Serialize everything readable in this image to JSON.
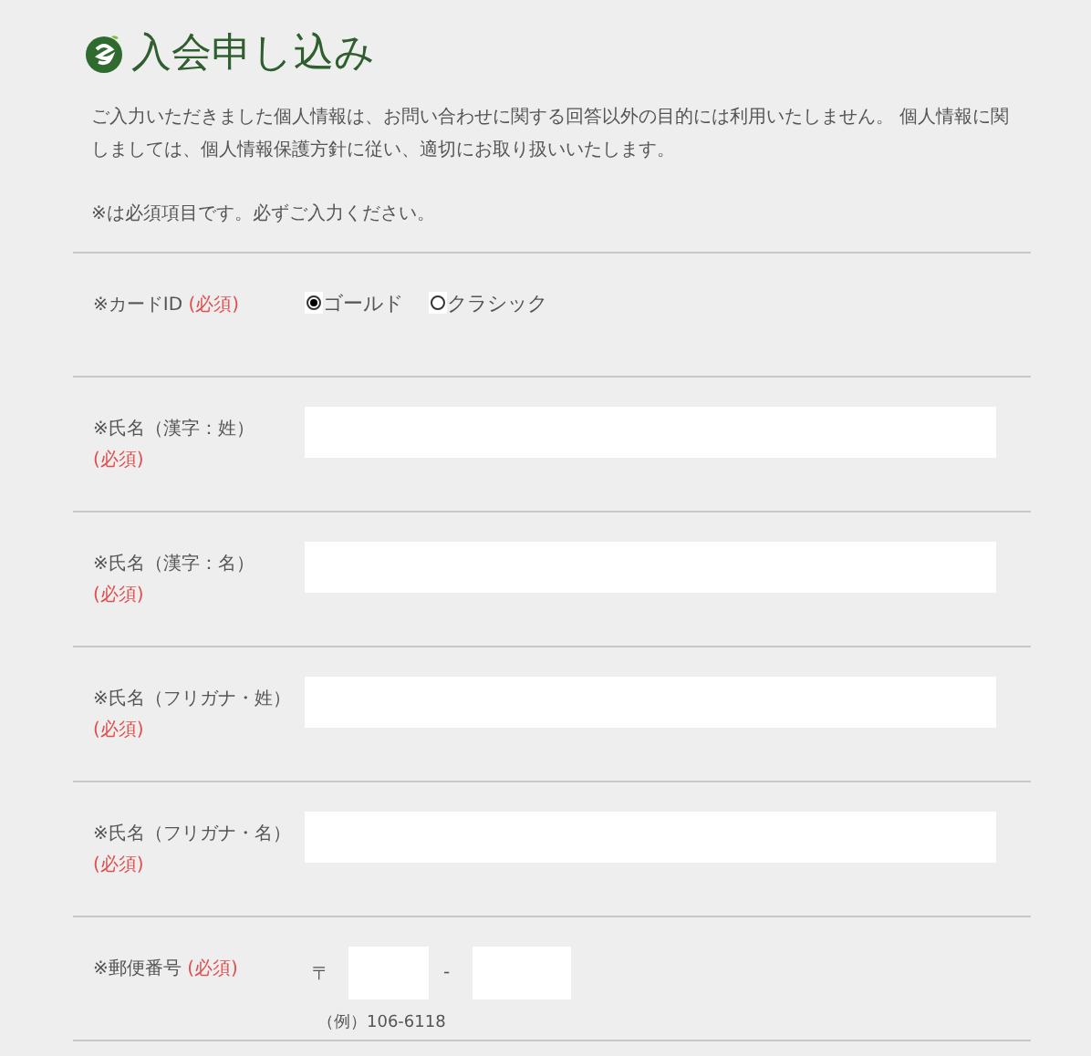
{
  "title": "入会申し込み",
  "intro": "ご入力いただきました個人情報は、お問い合わせに関する回答以外の目的には利用いたしません。 個人情報に関しましては、個人情報保護方針に従い、適切にお取り扱いいたします。",
  "note": "※は必須項目です。必ずご入力ください。",
  "rows": [
    {
      "kind": "radio",
      "label": "※カードID",
      "required": "(必須)",
      "options": [
        {
          "label": "ゴールド",
          "selected": true
        },
        {
          "label": "クラシック",
          "selected": false
        }
      ]
    },
    {
      "kind": "text",
      "label": "※氏名（漢字：姓）",
      "required": "(必須)"
    },
    {
      "kind": "text",
      "label": "※氏名（漢字：名）",
      "required": "(必須)"
    },
    {
      "kind": "text",
      "label": "※氏名（フリガナ・姓）",
      "required": "(必須)"
    },
    {
      "kind": "text",
      "label": "※氏名（フリガナ・名）",
      "required": "(必須)"
    },
    {
      "kind": "postal",
      "label": "※郵便番号",
      "required": "(必須)",
      "prefix": "〒",
      "separator": "-",
      "example": "（例）106-6118"
    }
  ]
}
